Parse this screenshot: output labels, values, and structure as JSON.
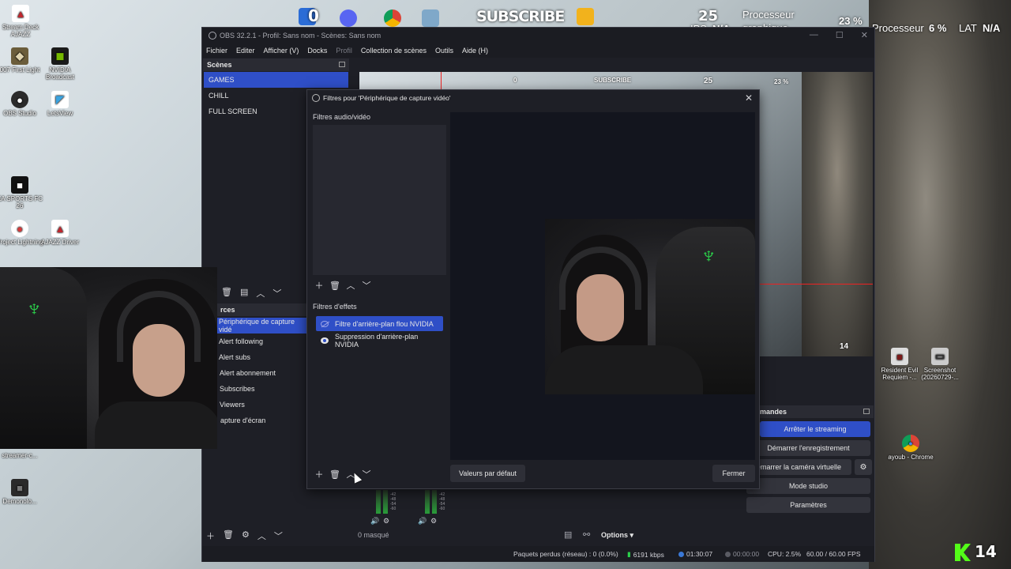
{
  "desktop": {
    "icons": [
      {
        "label": "Stream Deck AJAZZ",
        "color": "#c0262d",
        "glyph": "▲"
      },
      {
        "label": "007 First Light",
        "color": "#6b5d3b",
        "glyph": "◆"
      },
      {
        "label": "NVIDIA Broadcast",
        "color": "#76b900",
        "glyph": "◼"
      },
      {
        "label": "OBS Studio",
        "color": "#2b2b2b",
        "glyph": "●"
      },
      {
        "label": "LetsView",
        "color": "#3aa3e0",
        "glyph": "◤"
      },
      {
        "label": "EA SPORTS FC 26",
        "color": "#111111",
        "glyph": "■"
      },
      {
        "label": "Project Lightning",
        "color": "#d43a3a",
        "glyph": "●"
      },
      {
        "label": "AJAZZ Driver",
        "color": "#c0262d",
        "glyph": "▲"
      },
      {
        "label": "streamer-c...",
        "color": "#2a2a2a",
        "glyph": "■"
      },
      {
        "label": "Demonolo...",
        "color": "#2a2a2a",
        "glyph": "■"
      },
      {
        "label": "Resident Evil Requiem -...",
        "color": "#7a1a1a",
        "glyph": "■"
      },
      {
        "label": "Screenshot (20260729-...",
        "color": "#cccccc",
        "glyph": "▭"
      },
      {
        "label": "ayoub - Chrome",
        "color": "#e8b21a",
        "glyph": "●"
      }
    ]
  },
  "overlay": {
    "follower_count": "0",
    "subscribe_text": "SUBSCRIBE",
    "fps_value": "25",
    "fps_label": "IPS",
    "fps_na": "N/A",
    "gpu_label_line1": "Processeur",
    "gpu_label_line2": "graphique",
    "gpu_percent": "23 %",
    "cpu_label": "Processeur",
    "cpu_percent": "6 %",
    "lat_label": "LAT",
    "lat_value": "N/A",
    "kick_count": "14"
  },
  "obs": {
    "title": "OBS 32.2.1 - Profil: Sans nom - Scènes: Sans nom",
    "menu": [
      "Fichier",
      "Editer",
      "Afficher (V)",
      "Docks",
      "Profil",
      "Collection de scènes",
      "Outils",
      "Aide (H)"
    ],
    "scenes_header": "Scènes",
    "scenes": [
      "GAMES",
      "CHILL",
      "FULL SCREEN"
    ],
    "sources_header": "rces",
    "sources": [
      "Périphérique de capture vidé",
      "Alert following",
      "Alert subs",
      "Alert abonnement",
      "Subscribes",
      "Viewers",
      "apture d'écran"
    ],
    "controls_header": "mandes",
    "controls": [
      "Arrêter le streaming",
      "Démarrer l'enregistrement",
      "émarrer la caméra virtuelle",
      "Mode studio",
      "Paramètres"
    ],
    "mixer_hidden": "0 masqué",
    "mixer_options": "Options",
    "meter_ticks": [
      "-42",
      "-48",
      "-54",
      "-60"
    ],
    "status": {
      "dropped": "Paquets perdus (réseau) : 0 (0.0%)",
      "bitrate": "6191 kbps",
      "stream_time": "01:30:07",
      "rec_time": "00:00:00",
      "cpu": "CPU: 2.5%",
      "fps": "60.00 / 60.00 FPS"
    },
    "preview_mini": {
      "count": "0",
      "subscribe": "SUBSCRIBE",
      "fps": "25",
      "gpu": "23 %",
      "kick": "14"
    }
  },
  "dialog": {
    "title": "Filtres pour 'Périphérique de capture vidéo'",
    "av_filters_label": "Filtres audio/vidéo",
    "effect_filters_label": "Filtres d'effets",
    "effect_filters": [
      {
        "name": "Filtre d'arrière-plan flou NVIDIA",
        "selected": true,
        "visible": false
      },
      {
        "name": "Suppression d'arrière-plan NVIDIA",
        "selected": false,
        "visible": true
      }
    ],
    "defaults_button": "Valeurs par défaut",
    "close_button": "Fermer"
  },
  "colors": {
    "accent": "#2f4fc7",
    "kick_green": "#53fc18",
    "razer_green": "#2bd14b"
  }
}
